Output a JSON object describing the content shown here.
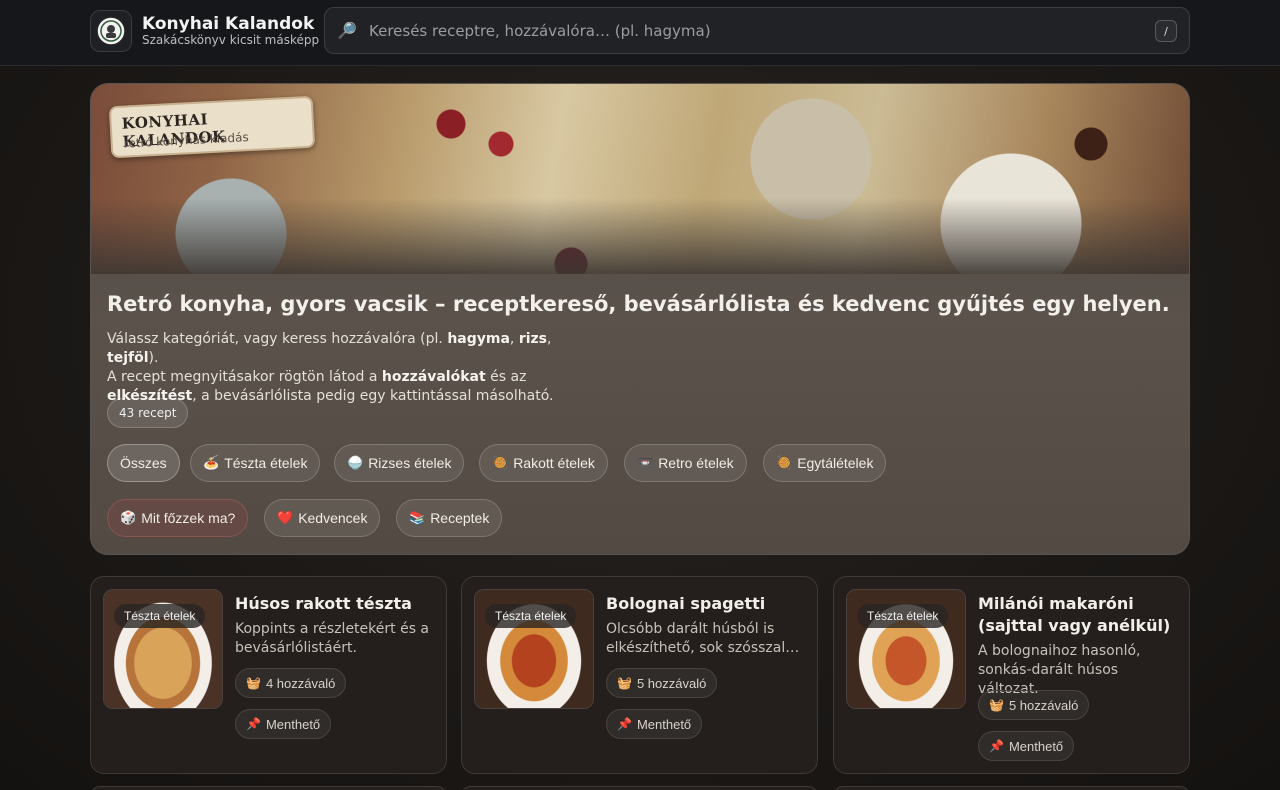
{
  "header": {
    "brand_title": "Konyhai Kalandok",
    "brand_subtitle": "Szakácskönyv kicsit másképp",
    "search_placeholder": "Keresés receptre, hozzávalóra… (pl. hagyma)",
    "search_value": "",
    "search_shortcut": "/"
  },
  "hero": {
    "badge_title": "KONYHAI KALANDOK",
    "badge_subtitle": "retró konyhás kiadás",
    "title": "Retró konyha, gyors vacsik – receptkereső, bevásárlólista és kedvenc gyűjtés egy helyen.",
    "desc": {
      "p1": "Válassz kategóriát, vagy keress hozzávalóra (pl. ",
      "kw1": "hagyma",
      "sep1": ", ",
      "kw2": "rizs",
      "sep2": ", ",
      "kw3": "tejföl",
      "p2": ").",
      "p3": "A recept megnyitásakor rögtön látod a ",
      "kw4": "hozzávalókat",
      "p4": " és az ",
      "kw5": "elkészítést",
      "p5": ", a bevásárlólista pedig egy kattintással másolható."
    },
    "count": "43 recept",
    "categories": [
      {
        "icon": "",
        "label": "Összes"
      },
      {
        "icon": "🍝",
        "label": "Tészta ételek"
      },
      {
        "icon": "🍚",
        "label": "Rizses ételek"
      },
      {
        "icon": "🥘",
        "label": "Rakott ételek"
      },
      {
        "icon": "📼",
        "label": "Retro ételek"
      },
      {
        "icon": "🥘",
        "label": "Egytálételek"
      }
    ],
    "actions": [
      {
        "icon": "🎲",
        "label": "Mit főzzek ma?"
      },
      {
        "icon": "❤️",
        "label": "Kedvencek"
      },
      {
        "icon": "📚",
        "label": "Receptek"
      }
    ]
  },
  "cards": [
    {
      "tag": "Tészta ételek",
      "title": "Húsos rakott tészta",
      "desc": "Koppints a részletekért és a bevásárlólistáért.",
      "ingredients": "4 hozzávaló",
      "save": "Menthető"
    },
    {
      "tag": "Tészta ételek",
      "title": "Bolognai spagetti",
      "desc": "Olcsóbb darált húsból is elkészíthető, sok szósszal…",
      "ingredients": "5 hozzávaló",
      "save": "Menthető"
    },
    {
      "tag": "Tészta ételek",
      "title": "Milánói makaróni (sajttal vagy anélkül)",
      "desc": "A bolognaihoz hasonló, sonkás-darált húsos változat.",
      "ingredients": "5 hozzávaló",
      "save": "Menthető"
    }
  ],
  "icons": {
    "search": "🔎",
    "basket": "🧺",
    "pin": "📌"
  }
}
